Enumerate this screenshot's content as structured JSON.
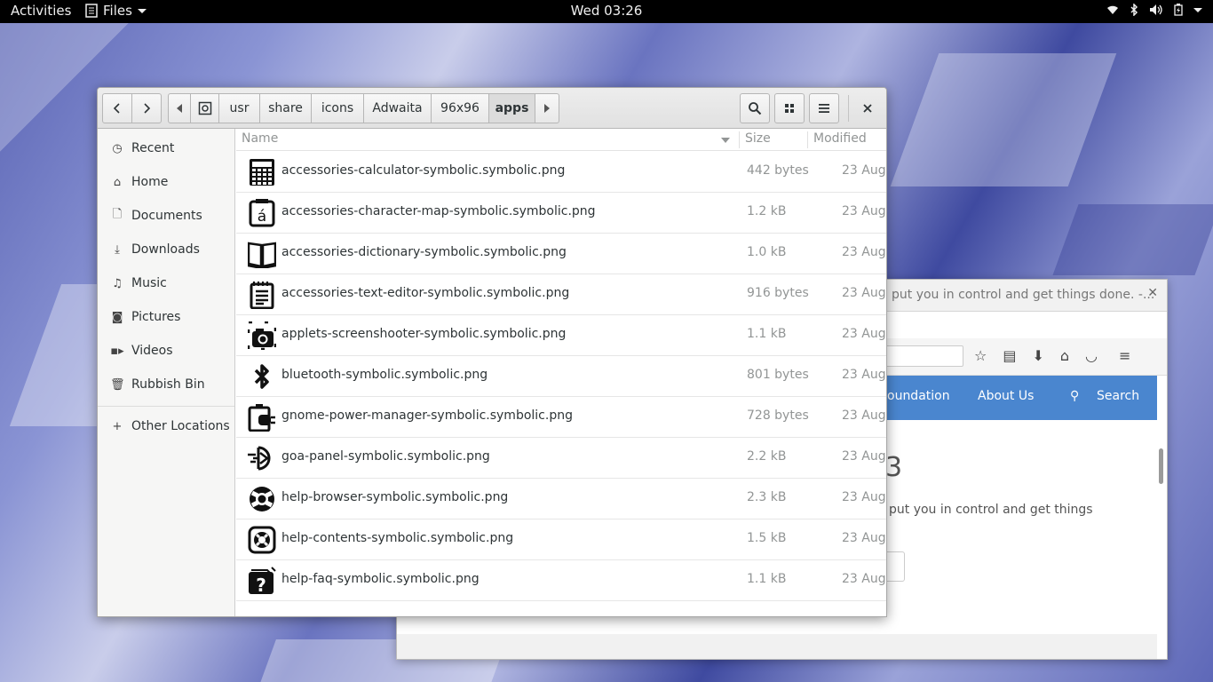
{
  "topbar": {
    "activities": "Activities",
    "app_menu": "Files",
    "clock": "Wed 03:26"
  },
  "browser": {
    "title": "put you in control and get things done. -...",
    "nav_items": [
      "oundation",
      "About Us",
      "Search"
    ],
    "heading": "3",
    "tagline": "put you in control and get things"
  },
  "files": {
    "breadcrumbs": [
      "usr",
      "share",
      "icons",
      "Adwaita",
      "96x96",
      "apps"
    ],
    "sidebar": {
      "items": [
        {
          "label": "Recent",
          "icon": "clock-icon"
        },
        {
          "label": "Home",
          "icon": "home-icon"
        },
        {
          "label": "Documents",
          "icon": "document-icon"
        },
        {
          "label": "Downloads",
          "icon": "download-icon"
        },
        {
          "label": "Music",
          "icon": "music-icon"
        },
        {
          "label": "Pictures",
          "icon": "camera-icon"
        },
        {
          "label": "Videos",
          "icon": "video-icon"
        },
        {
          "label": "Rubbish Bin",
          "icon": "trash-icon"
        }
      ],
      "other_locations": "Other Locations"
    },
    "columns": {
      "name": "Name",
      "size": "Size",
      "modified": "Modified"
    },
    "rows": [
      {
        "name": "accessories-calculator-symbolic.symbolic.png",
        "size": "442 bytes",
        "modified": "23 Aug",
        "icon": "calculator-icon"
      },
      {
        "name": "accessories-character-map-symbolic.symbolic.png",
        "size": "1.2 kB",
        "modified": "23 Aug",
        "icon": "character-map-icon"
      },
      {
        "name": "accessories-dictionary-symbolic.symbolic.png",
        "size": "1.0 kB",
        "modified": "23 Aug",
        "icon": "dictionary-icon"
      },
      {
        "name": "accessories-text-editor-symbolic.symbolic.png",
        "size": "916 bytes",
        "modified": "23 Aug",
        "icon": "text-editor-icon"
      },
      {
        "name": "applets-screenshooter-symbolic.symbolic.png",
        "size": "1.1 kB",
        "modified": "23 Aug",
        "icon": "screenshooter-icon"
      },
      {
        "name": "bluetooth-symbolic.symbolic.png",
        "size": "801 bytes",
        "modified": "23 Aug",
        "icon": "bluetooth-icon"
      },
      {
        "name": "gnome-power-manager-symbolic.symbolic.png",
        "size": "728 bytes",
        "modified": "23 Aug",
        "icon": "power-manager-icon"
      },
      {
        "name": "goa-panel-symbolic.symbolic.png",
        "size": "2.2 kB",
        "modified": "23 Aug",
        "icon": "goa-panel-icon"
      },
      {
        "name": "help-browser-symbolic.symbolic.png",
        "size": "2.3 kB",
        "modified": "23 Aug",
        "icon": "lifebuoy-icon"
      },
      {
        "name": "help-contents-symbolic.symbolic.png",
        "size": "1.5 kB",
        "modified": "23 Aug",
        "icon": "help-contents-icon"
      },
      {
        "name": "help-faq-symbolic.symbolic.png",
        "size": "1.1 kB",
        "modified": "23 Aug",
        "icon": "help-faq-icon"
      }
    ]
  }
}
